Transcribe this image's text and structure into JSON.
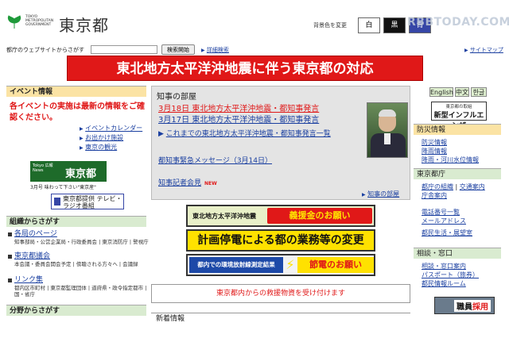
{
  "header": {
    "logo_small": "TOKYO METROPOLITAN GOVERNMENT",
    "logo_big": "東京都",
    "bg_color_label": "背景色を変更",
    "bg_white": "白",
    "bg_black": "黒",
    "bg_blue": "青",
    "watermark": "RBBTODAY.COM"
  },
  "search": {
    "label": "都庁のウェブサイトからさがす",
    "value": "",
    "button": "検索開始",
    "advanced": "詳細検索",
    "sitemap": "サイトマップ"
  },
  "banner": {
    "quake": "東北地方太平洋沖地震に伴う東京都の対応"
  },
  "left": {
    "event_head": "イベント情報",
    "event_notice": "各イベントの実施は最新の情報をご確認ください。",
    "event_links": [
      "イベントカレンダー",
      "お出かけ施設",
      "東京の観光"
    ],
    "tokyo_news_small": "Tokyo 広報 News",
    "tokyo_news_big": "東京都",
    "news_caption": "3月号 味わって下さい\"東京産\"",
    "tv_radio": "東京都提供 テレビ・ラジオ番組",
    "org_head": "組織からさがす",
    "orgs": [
      {
        "title": "各局のページ",
        "sub": "知事部局・公営企業局・行政委員会 | 東京消防庁 | 警視庁"
      },
      {
        "title": "東京都議会",
        "sub": "本会議・委員会開会予定 | 傍聴される方々へ | 会議録"
      },
      {
        "title": "リンク集",
        "sub": "都内区市町村 | 東京都監理団体 | 道府県・政令指定都市 | 国・省庁"
      }
    ],
    "field_head": "分野からさがす"
  },
  "governor": {
    "head": "知事の部屋",
    "item1": "3月18日 東北地方太平洋沖地震・都知事発言",
    "item2": "3月17日 東北地方太平洋沖地震・都知事発言",
    "item3": "これまでの東北地方太平洋沖地震・都知事発言一覧",
    "message": "都知事緊急メッセージ（3月14日）",
    "press": "知事記者会見",
    "new_badge": "NEW",
    "more": "知事の部屋"
  },
  "banners": {
    "donation_left": "東北地方太平洋沖地震",
    "donation_right": "義援金のお願い",
    "blackout": "計画停電による都の業務等の変更",
    "radiation_left": "都内での環境放射線測定結果",
    "radiation_right": "節電のお願い",
    "supplies": "東京都内からの救援物資を受け付けます",
    "new_info": "新着情報"
  },
  "right": {
    "lang_en": "English",
    "lang_cn": "中文",
    "lang_kr": "한글",
    "flu_small": "東京都の取組",
    "flu_big": "新型インフルエンザ",
    "disaster_head": "防災情報",
    "disaster_links": [
      "防災情報",
      "降雨情報",
      "降雨・河川水位情報"
    ],
    "gov_office_head": "東京都庁",
    "gov_office_links": [
      "都庁の組織",
      "交通案内",
      "庁舎案内"
    ],
    "gov_office_links2": [
      "電話番号一覧",
      "メールアドレス",
      "都民生活・展望室"
    ],
    "consult_head": "相談・窓口",
    "consult_links": [
      "相談・窓口案内",
      "パスポート（旅券）",
      "都民情報ルーム"
    ],
    "recruit_a": "職員",
    "recruit_b": "採用"
  }
}
